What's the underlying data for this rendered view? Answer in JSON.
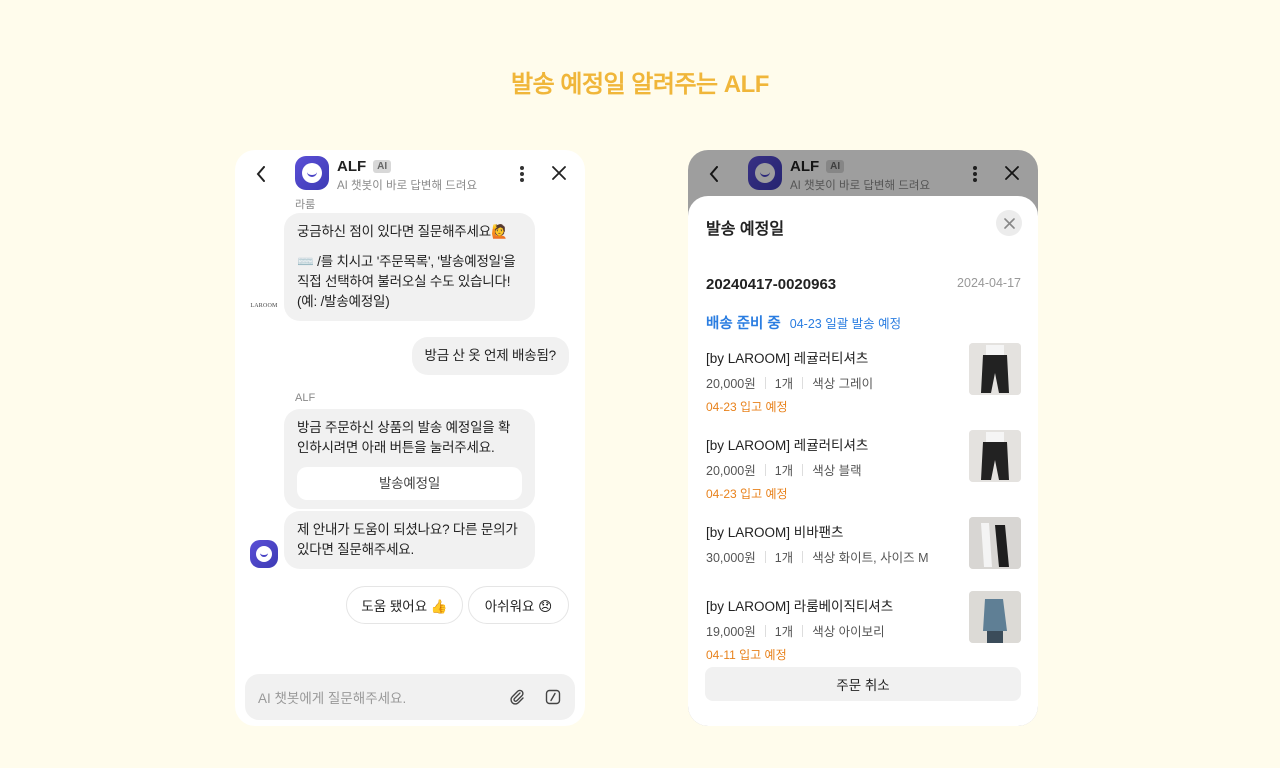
{
  "page": {
    "title": "발송 예정일 알려주는 ALF"
  },
  "header": {
    "bot_name": "ALF",
    "ai_badge": "AI",
    "subtitle": "AI 챗봇이 바로 답변해 드려요",
    "back_icon": "chevron-left-icon",
    "more_icon": "more-vertical-icon",
    "close_icon": "close-icon"
  },
  "chat": {
    "brand_sender": "라룸",
    "brand_logo_text": "LAROOM",
    "brand_msg_1": "궁금하신 점이 있다면 질문해주세요🙋",
    "brand_msg_2": "⌨️ /를 치시고 '주문목록', '발송예정일'을 직접 선택하여 불러오실 수도 있습니다! (예: /발송예정일)",
    "user_msg": "방금 산 옷 언제 배송됨?",
    "alf_sender": "ALF",
    "alf_msg_1": "방금 주문하신 상품의 발송 예정일을 확인하시려면 아래 버튼을 눌러주세요.",
    "alf_button": "발송예정일",
    "alf_msg_2": "제 안내가 도움이 되셨나요? 다른 문의가 있다면 질문해주세요.",
    "feedback_yes": "도움 됐어요 👍",
    "feedback_no": "아쉬워요 😞",
    "input_placeholder": "AI 챗봇에게 질문해주세요."
  },
  "sheet": {
    "title": "발송 예정일",
    "order_number": "20240417-0020963",
    "order_date": "2024-04-17",
    "status": "배송 준비 중",
    "status_detail": "04-23 일괄 발송 예정",
    "items": [
      {
        "name": "[by LAROOM] 레귤러티셔츠",
        "price": "20,000원",
        "qty": "1개",
        "option": "색상 그레이",
        "eta": "04-23 입고 예정"
      },
      {
        "name": "[by LAROOM] 레귤러티셔츠",
        "price": "20,000원",
        "qty": "1개",
        "option": "색상 블랙",
        "eta": "04-23 입고 예정"
      },
      {
        "name": "[by LAROOM] 비바팬츠",
        "price": "30,000원",
        "qty": "1개",
        "option": "색상 화이트, 사이즈 M",
        "eta": ""
      },
      {
        "name": "[by LAROOM] 라룸베이직티셔츠",
        "price": "19,000원",
        "qty": "1개",
        "option": "색상 아이보리",
        "eta": "04-11 입고 예정"
      }
    ],
    "cancel_button": "주문 취소"
  },
  "colors": {
    "background": "#fffcec",
    "title": "#f0b63a",
    "status_blue": "#2a7de1",
    "eta_orange": "#e8821c",
    "bot_purple": "#4a44c6"
  }
}
